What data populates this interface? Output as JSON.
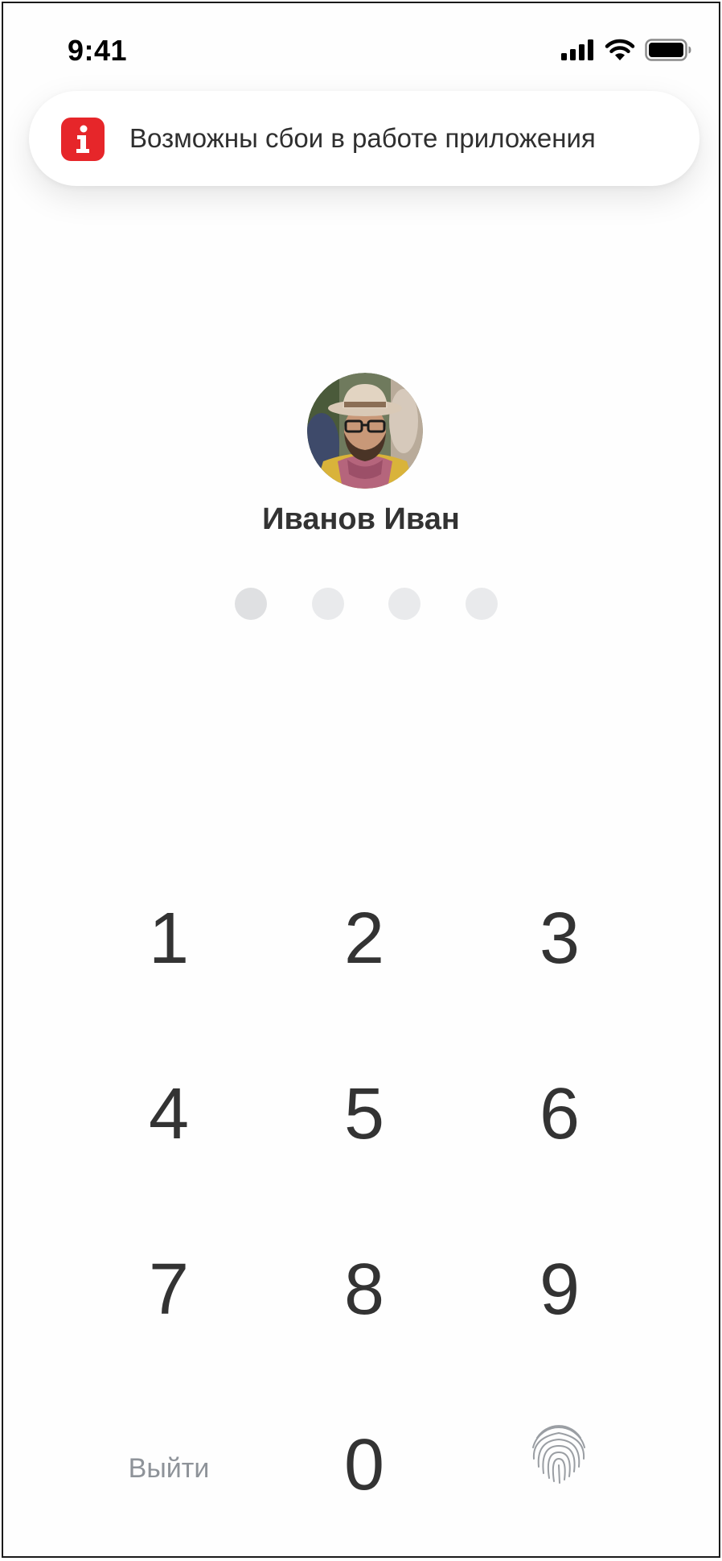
{
  "status_bar": {
    "time": "9:41",
    "icons": [
      "signal-icon",
      "wifi-icon",
      "battery-icon"
    ]
  },
  "alert": {
    "icon": "info-icon",
    "icon_color": "#e6262a",
    "message": "Возможны сбои в работе приложения"
  },
  "user": {
    "name": "Иванов Иван",
    "avatar": "user-avatar"
  },
  "pin": {
    "length": 4,
    "entered": 0
  },
  "keypad": {
    "keys": [
      "1",
      "2",
      "3",
      "4",
      "5",
      "6",
      "7",
      "8",
      "9",
      "0"
    ],
    "logout_label": "Выйти",
    "biometric_icon": "fingerprint-icon"
  },
  "colors": {
    "accent": "#e6262a",
    "text": "#333333",
    "muted": "#8e9399",
    "dot": "#e9eaec"
  }
}
